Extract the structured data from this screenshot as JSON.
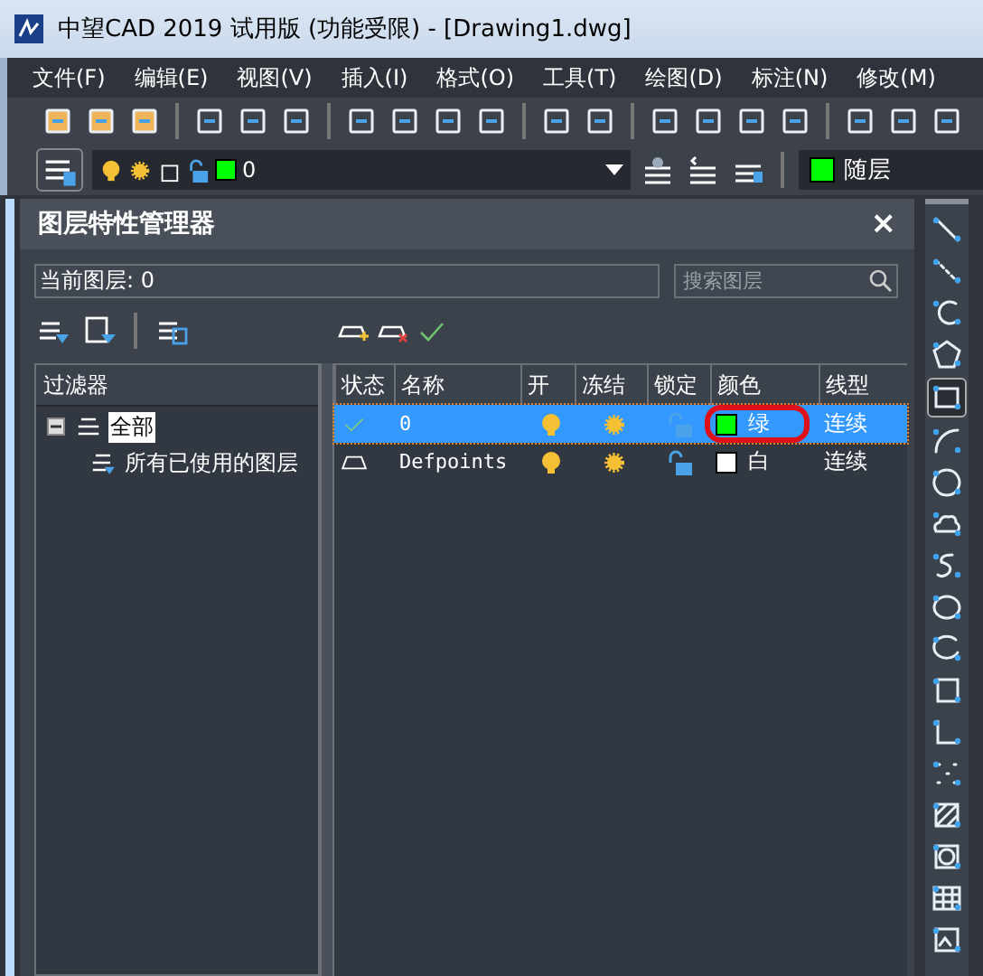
{
  "window": {
    "title": "中望CAD 2019 试用版 (功能受限) - [Drawing1.dwg]"
  },
  "menu": [
    "文件(F)",
    "编辑(E)",
    "视图(V)",
    "插入(I)",
    "格式(O)",
    "工具(T)",
    "绘图(D)",
    "标注(N)",
    "修改(M)"
  ],
  "layer_toolbar": {
    "layer": {
      "name": "0",
      "color": "#00ff00"
    },
    "property": {
      "label": "随层",
      "color": "#00ff00"
    }
  },
  "panel": {
    "title": "图层特性管理器",
    "close": "×",
    "current_layer_label": "当前图层: 0",
    "search": {
      "placeholder": "搜索图层"
    },
    "filters": {
      "heading": "过滤器",
      "tree": [
        {
          "label": "全部",
          "selected": true,
          "expanded": true,
          "children": [
            {
              "label": "所有已使用的图层",
              "selected": false
            }
          ]
        }
      ]
    },
    "table": {
      "columns": [
        "状态",
        "名称",
        "开",
        "冻结",
        "锁定",
        "颜色",
        "线型"
      ],
      "rows": [
        {
          "current": true,
          "name": "0",
          "on": true,
          "frozen": false,
          "locked": false,
          "color_name": "绿",
          "color": "#00ff00",
          "linetype": "连续",
          "selected": true,
          "circled": true
        },
        {
          "current": false,
          "name": "Defpoints",
          "on": true,
          "frozen": false,
          "locked": false,
          "color_name": "白",
          "color": "#ffffff",
          "linetype": "连续",
          "selected": false,
          "circled": false
        }
      ]
    }
  }
}
